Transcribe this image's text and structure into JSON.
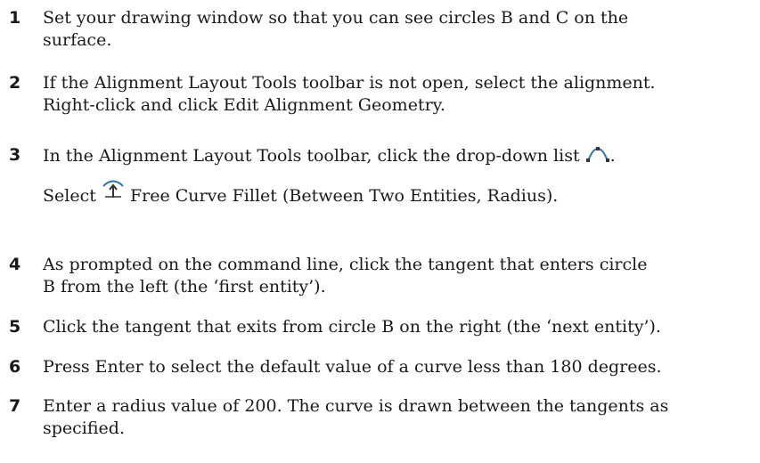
{
  "steps": [
    {
      "number": "1",
      "lines": [
        "Set your drawing window so that you can see circles B and C on the",
        "surface."
      ]
    },
    {
      "number": "2",
      "lines": [
        "If the Alignment Layout Tools toolbar is not open, select the alignment.",
        "Right-click and click Edit Alignment Geometry."
      ]
    },
    {
      "number": "3",
      "line1": "In the Alignment Layout Tools toolbar, click the drop-down list",
      "line1_end": ".",
      "line2_prefix": "Select",
      "line2_text": "Free Curve Fillet (Between Two Entities, Radius)."
    },
    {
      "number": "4",
      "lines": [
        "As prompted on the command line, click the tangent that enters circle",
        "B from the left (the ‘first entity’)."
      ]
    },
    {
      "number": "5",
      "lines": [
        "Click the tangent that exits from circle B on the right (the ‘next entity’)."
      ]
    },
    {
      "number": "6",
      "lines": [
        "Press Enter to select the default value of a curve less than 180 degrees."
      ]
    },
    {
      "number": "7",
      "lines": [
        "Enter a radius value of 200. The curve is drawn between the tangents as",
        "specified."
      ]
    }
  ],
  "icons": {
    "dropdown_icon": "curve-dropdown-icon",
    "fillet_icon": "free-curve-fillet-icon"
  },
  "colors": {
    "icon_blue": "#2f6fb3",
    "icon_dark": "#333333"
  }
}
